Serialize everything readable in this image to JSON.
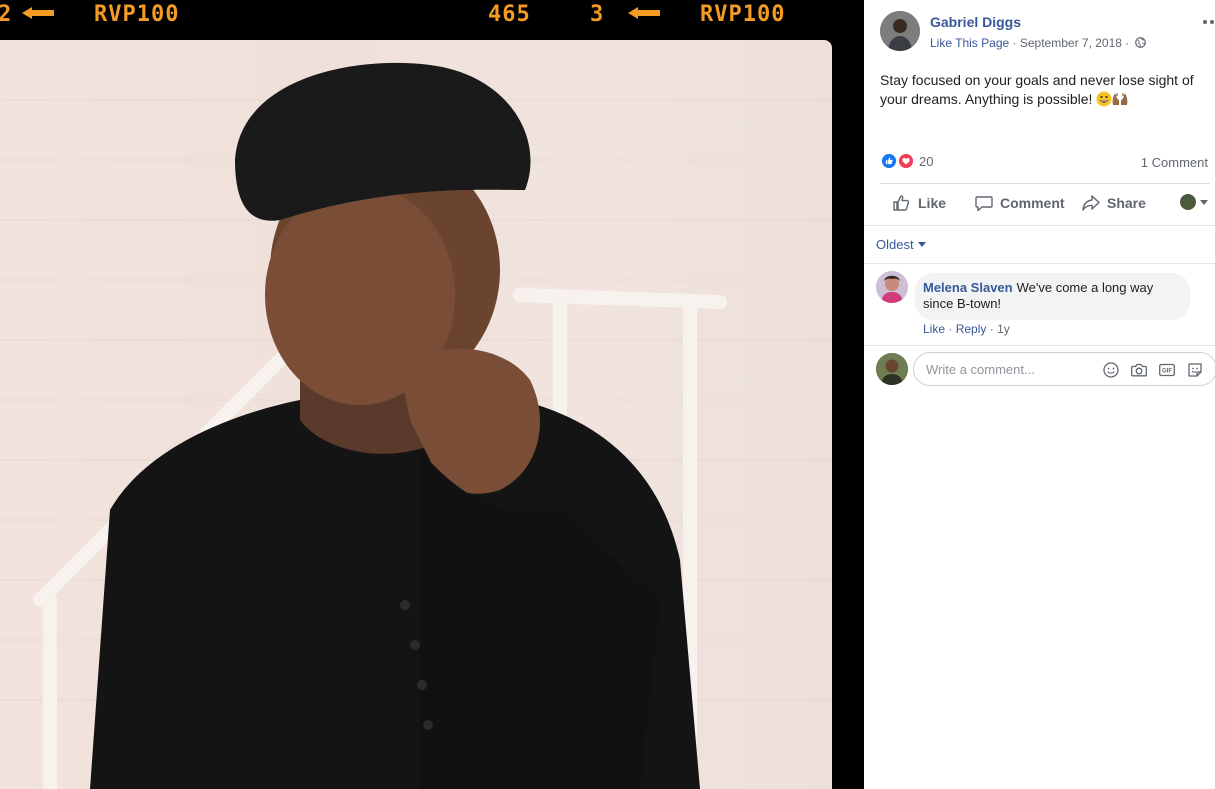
{
  "film_strip": {
    "left_code": "RVP100",
    "frame_number": "465",
    "frame_count": "3",
    "right_code": "RVP100",
    "color": "#f39b22"
  },
  "post": {
    "author": "Gabriel Diggs",
    "like_page": "Like This Page",
    "separator": "·",
    "date": "September 7, 2018",
    "privacy_icon": "globe-icon",
    "more_icon": "more-options-icon",
    "text": "Stay focused on your goals and never lose sight of your dreams. Anything is possible!",
    "emojis": [
      "grinning-face-emoji",
      "raised-hands-emoji"
    ]
  },
  "reactions": {
    "icons": [
      "like-reaction-icon",
      "love-reaction-icon"
    ],
    "count": "20",
    "comment_count": "1 Comment"
  },
  "actions": {
    "like": "Like",
    "comment": "Comment",
    "share": "Share"
  },
  "comments_sort": "Oldest",
  "comments": [
    {
      "author": "Melena Slaven",
      "text": "We've come a long way since B-town!",
      "like": "Like",
      "reply": "Reply",
      "age": "1y"
    }
  ],
  "composer": {
    "placeholder": "Write a comment...",
    "icons": [
      "emoji-icon",
      "camera-icon",
      "gif-icon",
      "sticker-icon"
    ]
  },
  "colors": {
    "link": "#385898",
    "like_blue": "#1877f2",
    "love_red": "#f33e58",
    "secondary_text": "#606770"
  }
}
